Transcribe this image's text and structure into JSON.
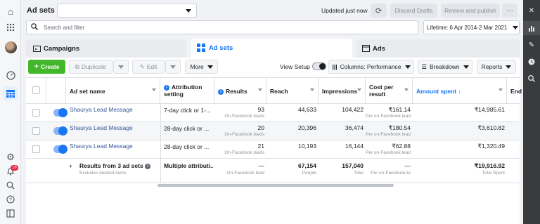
{
  "header": {
    "title": "Ad sets",
    "updated_text": "Updated just now",
    "discard_label": "Discard Drafts",
    "review_label": "Review and publish",
    "more_label": "···"
  },
  "search": {
    "placeholder": "Search and filter"
  },
  "date_range": {
    "label": "Lifetime: 6 Apr 2014-2 Mar 2021"
  },
  "tabs": [
    {
      "label": "Campaigns",
      "active": false
    },
    {
      "label": "Ad sets",
      "active": true
    },
    {
      "label": "Ads",
      "active": false
    }
  ],
  "toolbar": {
    "create": "Create",
    "duplicate": "Duplicate",
    "edit": "Edit",
    "more": "More",
    "view_setup": "View Setup",
    "columns": "Columns: Performance",
    "breakdown": "Breakdown",
    "reports": "Reports"
  },
  "table": {
    "columns": [
      "Ad set name",
      "Attribution setting",
      "Results",
      "Reach",
      "Impressions",
      "Cost per result",
      "Amount spent",
      "End"
    ],
    "rows": [
      {
        "name": "Shaurya Lead Message",
        "attribution": "7-day click or 1-...",
        "results": "93",
        "results_sub": "On-Facebook leads",
        "reach": "44,633",
        "impressions": "104,422",
        "cost": "₹161.14",
        "cost_sub": "Per on-Facebook leads",
        "spent": "₹14,985.61"
      },
      {
        "name": "Shaurya Lead Message",
        "attribution": "28-day click or ...",
        "results": "20",
        "results_sub": "On-Facebook leads",
        "reach": "20,396",
        "impressions": "36,474",
        "cost": "₹180.54",
        "cost_sub": "Per on-Facebook leads",
        "spent": "₹3,610.82"
      },
      {
        "name": "Shaurya Lead Message",
        "attribution": "28-day click or ...",
        "results": "21",
        "results_sub": "On-Facebook leads",
        "reach": "10,193",
        "impressions": "16,144",
        "cost": "₹62.88",
        "cost_sub": "Per on-Facebook leads",
        "spent": "₹1,320.49"
      }
    ],
    "summary": {
      "label": "Results from 3 ad sets",
      "sub": "Excludes deleted items",
      "attribution": "Multiple attributi...",
      "results": "—",
      "results_sub": "On-Facebook lead",
      "reach": "67,154",
      "reach_sub": "People",
      "impressions": "157,040",
      "impressions_sub": "Total",
      "cost": "—",
      "cost_sub": "Per on-Facebook le",
      "spent": "₹19,916.92",
      "spent_sub": "Total Spent"
    }
  },
  "left_rail": {
    "notification_count": "18"
  },
  "colors": {
    "accent": "#1877f2",
    "create": "#42b72a",
    "right_rail": "#3a3b3c"
  }
}
